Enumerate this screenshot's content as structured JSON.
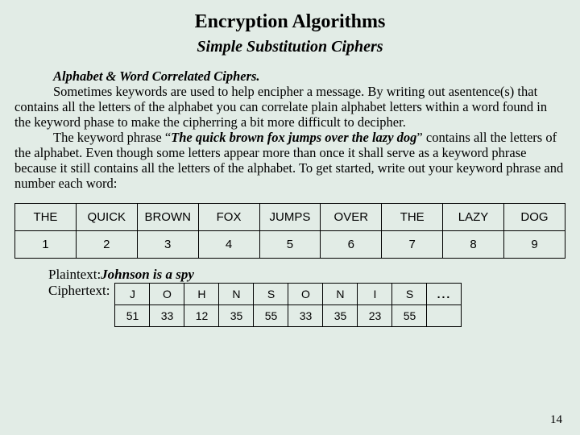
{
  "title": "Encryption Algorithms",
  "subtitle": "Simple Substitution Ciphers",
  "section_heading": "Alphabet & Word Correlated Ciphers.",
  "para1_a": "Sometimes keywords are used to help encipher a message. By writing out a ",
  "para1_b": "sentence(s) that contains all the letters of the alphabet you can correlate plain alphabet letters within a word found in the keyword phase to make the cipherring a bit more difficult to decipher.",
  "para2_a": "The keyword phrase “",
  "para2_kw": "The quick brown fox jumps over the lazy dog",
  "para2_b": "” contains ",
  "para2_c": "all the letters of the alphabet. Even though some letters appear more than once it shall serve as a keyword phrase because it still contains all the letters of the alphabet. To get started, write out your keyword phrase and number each word:",
  "words_table": {
    "row1": [
      "THE",
      "QUICK",
      "BROWN",
      "FOX",
      "JUMPS",
      "OVER",
      "THE",
      "LAZY",
      "DOG"
    ],
    "row2": [
      "1",
      "2",
      "3",
      "4",
      "5",
      "6",
      "7",
      "8",
      "9"
    ]
  },
  "plaintext_label": "Plaintext: ",
  "plaintext_value": "Johnson is a spy",
  "ciphertext_label": "Ciphertext:",
  "cipher_table": {
    "row1": [
      "J",
      "O",
      "H",
      "N",
      "S",
      "O",
      "N",
      "I",
      "S",
      "..."
    ],
    "row2": [
      "51",
      "33",
      "12",
      "35",
      "55",
      "33",
      "35",
      "23",
      "55",
      ""
    ]
  },
  "page_number": "14"
}
